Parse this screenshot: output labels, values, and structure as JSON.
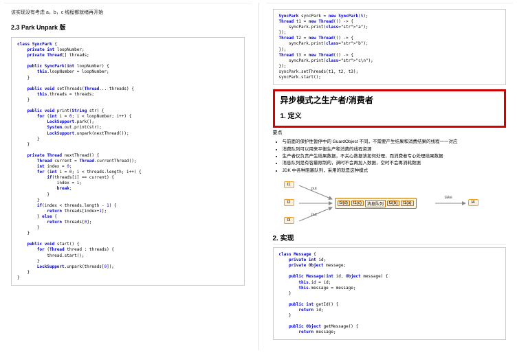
{
  "left": {
    "intro": "该实现没有考虑 a，b，c 线程都就绪再开始",
    "heading": "2.3 Park Unpark 版",
    "code": "class SyncPark {\n    private int loopNumber;\n    private Thread[] threads;\n\n    public SyncPark(int loopNumber) {\n        this.loopNumber = loopNumber;\n    }\n\n    public void setThreads(Thread... threads) {\n        this.threads = threads;\n    }\n\n    public void print(String str) {\n        for (int i = 0; i < loopNumber; i++) {\n            LockSupport.park();\n            System.out.print(str);\n            LockSupport.unpark(nextThread());\n        }\n    }\n\n    private Thread nextThread() {\n        Thread current = Thread.currentThread();\n        int index = 0;\n        for (int i = 0; i < threads.length; i++) {\n            if(threads[i] == current) {\n                index = i;\n                break;\n            }\n        }\n        if(index < threads.length - 1) {\n            return threads[index+1];\n        } else {\n            return threads[0];\n        }\n    }\n\n    public void start() {\n        for (Thread thread : threads) {\n            thread.start();\n        }\n        LockSupport.unpark(threads[0]);\n    }\n}"
  },
  "right": {
    "codeTop": "SyncPark syncPark = new SyncPark(5);\nThread t1 = new Thread(() -> {\n    syncPark.print(\"a\");\n});\nThread t2 = new Thread(() -> {\n    syncPark.print(\"b\");\n});\nThread t3 = new Thread(() -> {\n    syncPark.print(\"c\\n\");\n});\nsyncPark.setThreads(t1, t2, t3);\nsyncPark.start();",
    "boxedTitle": "异步模式之生产者/消费者",
    "sec1": "1. 定义",
    "keypointLabel": "要点",
    "bullets": [
      "与前面的保护性暂停中的 GuardObject 不同，不需要产生结果和消费结果的线程一一对应",
      "消费队列可以用来平衡生产和消费的线程资源",
      "生产者仅负责产生结果数据，不关心数据该如何处理，而消费者专心处理结果数据",
      "消息队列是有容量限制的，满时不会再加入数据，空时不会再消耗数据",
      "JDK 中各种阻塞队列，采用的就是这种模式"
    ],
    "diagram": {
      "producers": [
        "t1",
        "t2",
        "t3"
      ],
      "put": "put",
      "queueItems": [
        "t3(d)",
        "t1(c)",
        "消息队列",
        "t2(b)",
        "t1(a)"
      ],
      "take": "take",
      "consumer": "t4"
    },
    "sec2": "2. 实现",
    "codeBottom": "class Message {\n    private int id;\n    private Object message;\n\n    public Message(int id, Object message) {\n        this.id = id;\n        this.message = message;\n    }\n\n    public int getId() {\n        return id;\n    }\n\n    public Object getMessage() {\n        return message;"
  }
}
